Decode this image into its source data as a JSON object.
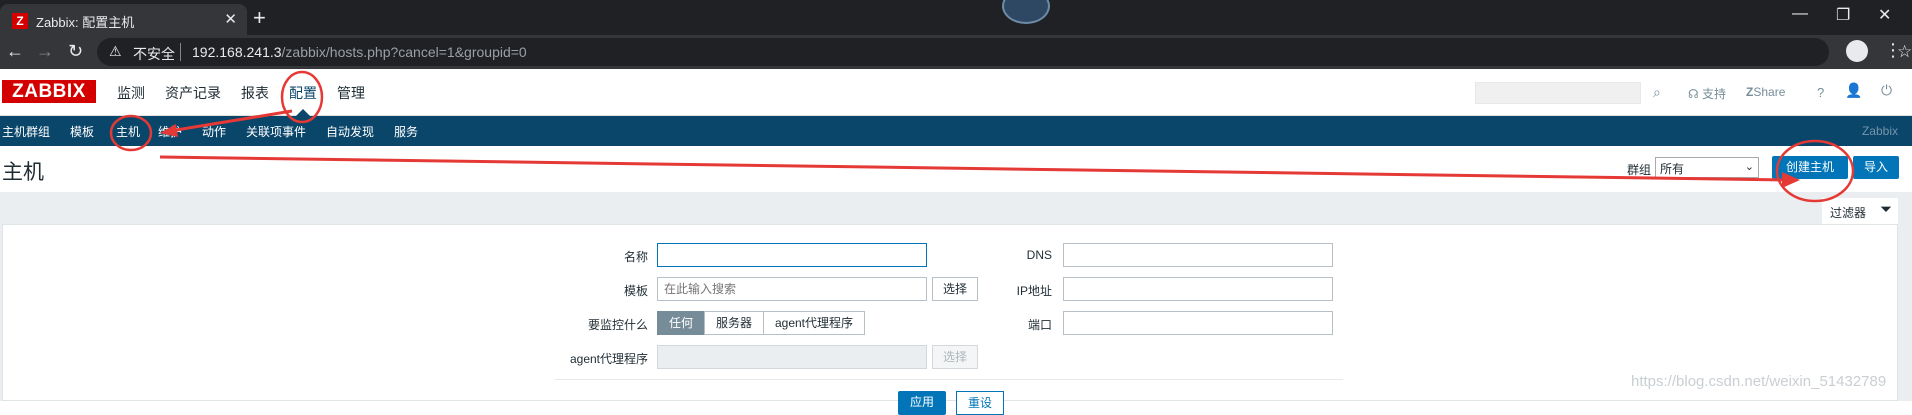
{
  "browser": {
    "tab_title": "Zabbix: 配置主机",
    "favicon_letter": "Z",
    "insecure_label": "不安全",
    "url_host": "192.168.241.3",
    "url_path": "/zabbix/hosts.php?cancel=1&groupid=0"
  },
  "header": {
    "logo": "ZABBIX",
    "menu": [
      "监测",
      "资产记录",
      "报表",
      "配置",
      "管理"
    ],
    "active_menu": "配置",
    "support": "支持",
    "share": "Share",
    "help": "?"
  },
  "submenu": {
    "items": [
      "主机群组",
      "模板",
      "主机",
      "维护",
      "动作",
      "关联项事件",
      "自动发现",
      "服务"
    ],
    "active": "主机",
    "brand": "Zabbix"
  },
  "page": {
    "title": "主机",
    "group_label": "群组",
    "group_value": "所有",
    "create_host": "创建主机",
    "import": "导入"
  },
  "filter": {
    "tab_label": "过滤器",
    "name_label": "名称",
    "name_value": "",
    "template_label": "模板",
    "template_placeholder": "在此输入搜索",
    "select_button": "选择",
    "monitored_by_label": "要监控什么",
    "monitored_by_options": [
      "任何",
      "服务器",
      "agent代理程序"
    ],
    "monitored_by_selected": "任何",
    "proxy_label": "agent代理程序",
    "proxy_select_button": "选择",
    "dns_label": "DNS",
    "ip_label": "IP地址",
    "port_label": "端口",
    "apply_button": "应用",
    "reset_button": "重设"
  },
  "watermark": "https://blog.csdn.net/weixin_51432789",
  "colors": {
    "zabbix_red": "#d40000",
    "nav_blue": "#0a466a",
    "button_blue": "#0275b8",
    "annotation_red": "#e53935"
  }
}
